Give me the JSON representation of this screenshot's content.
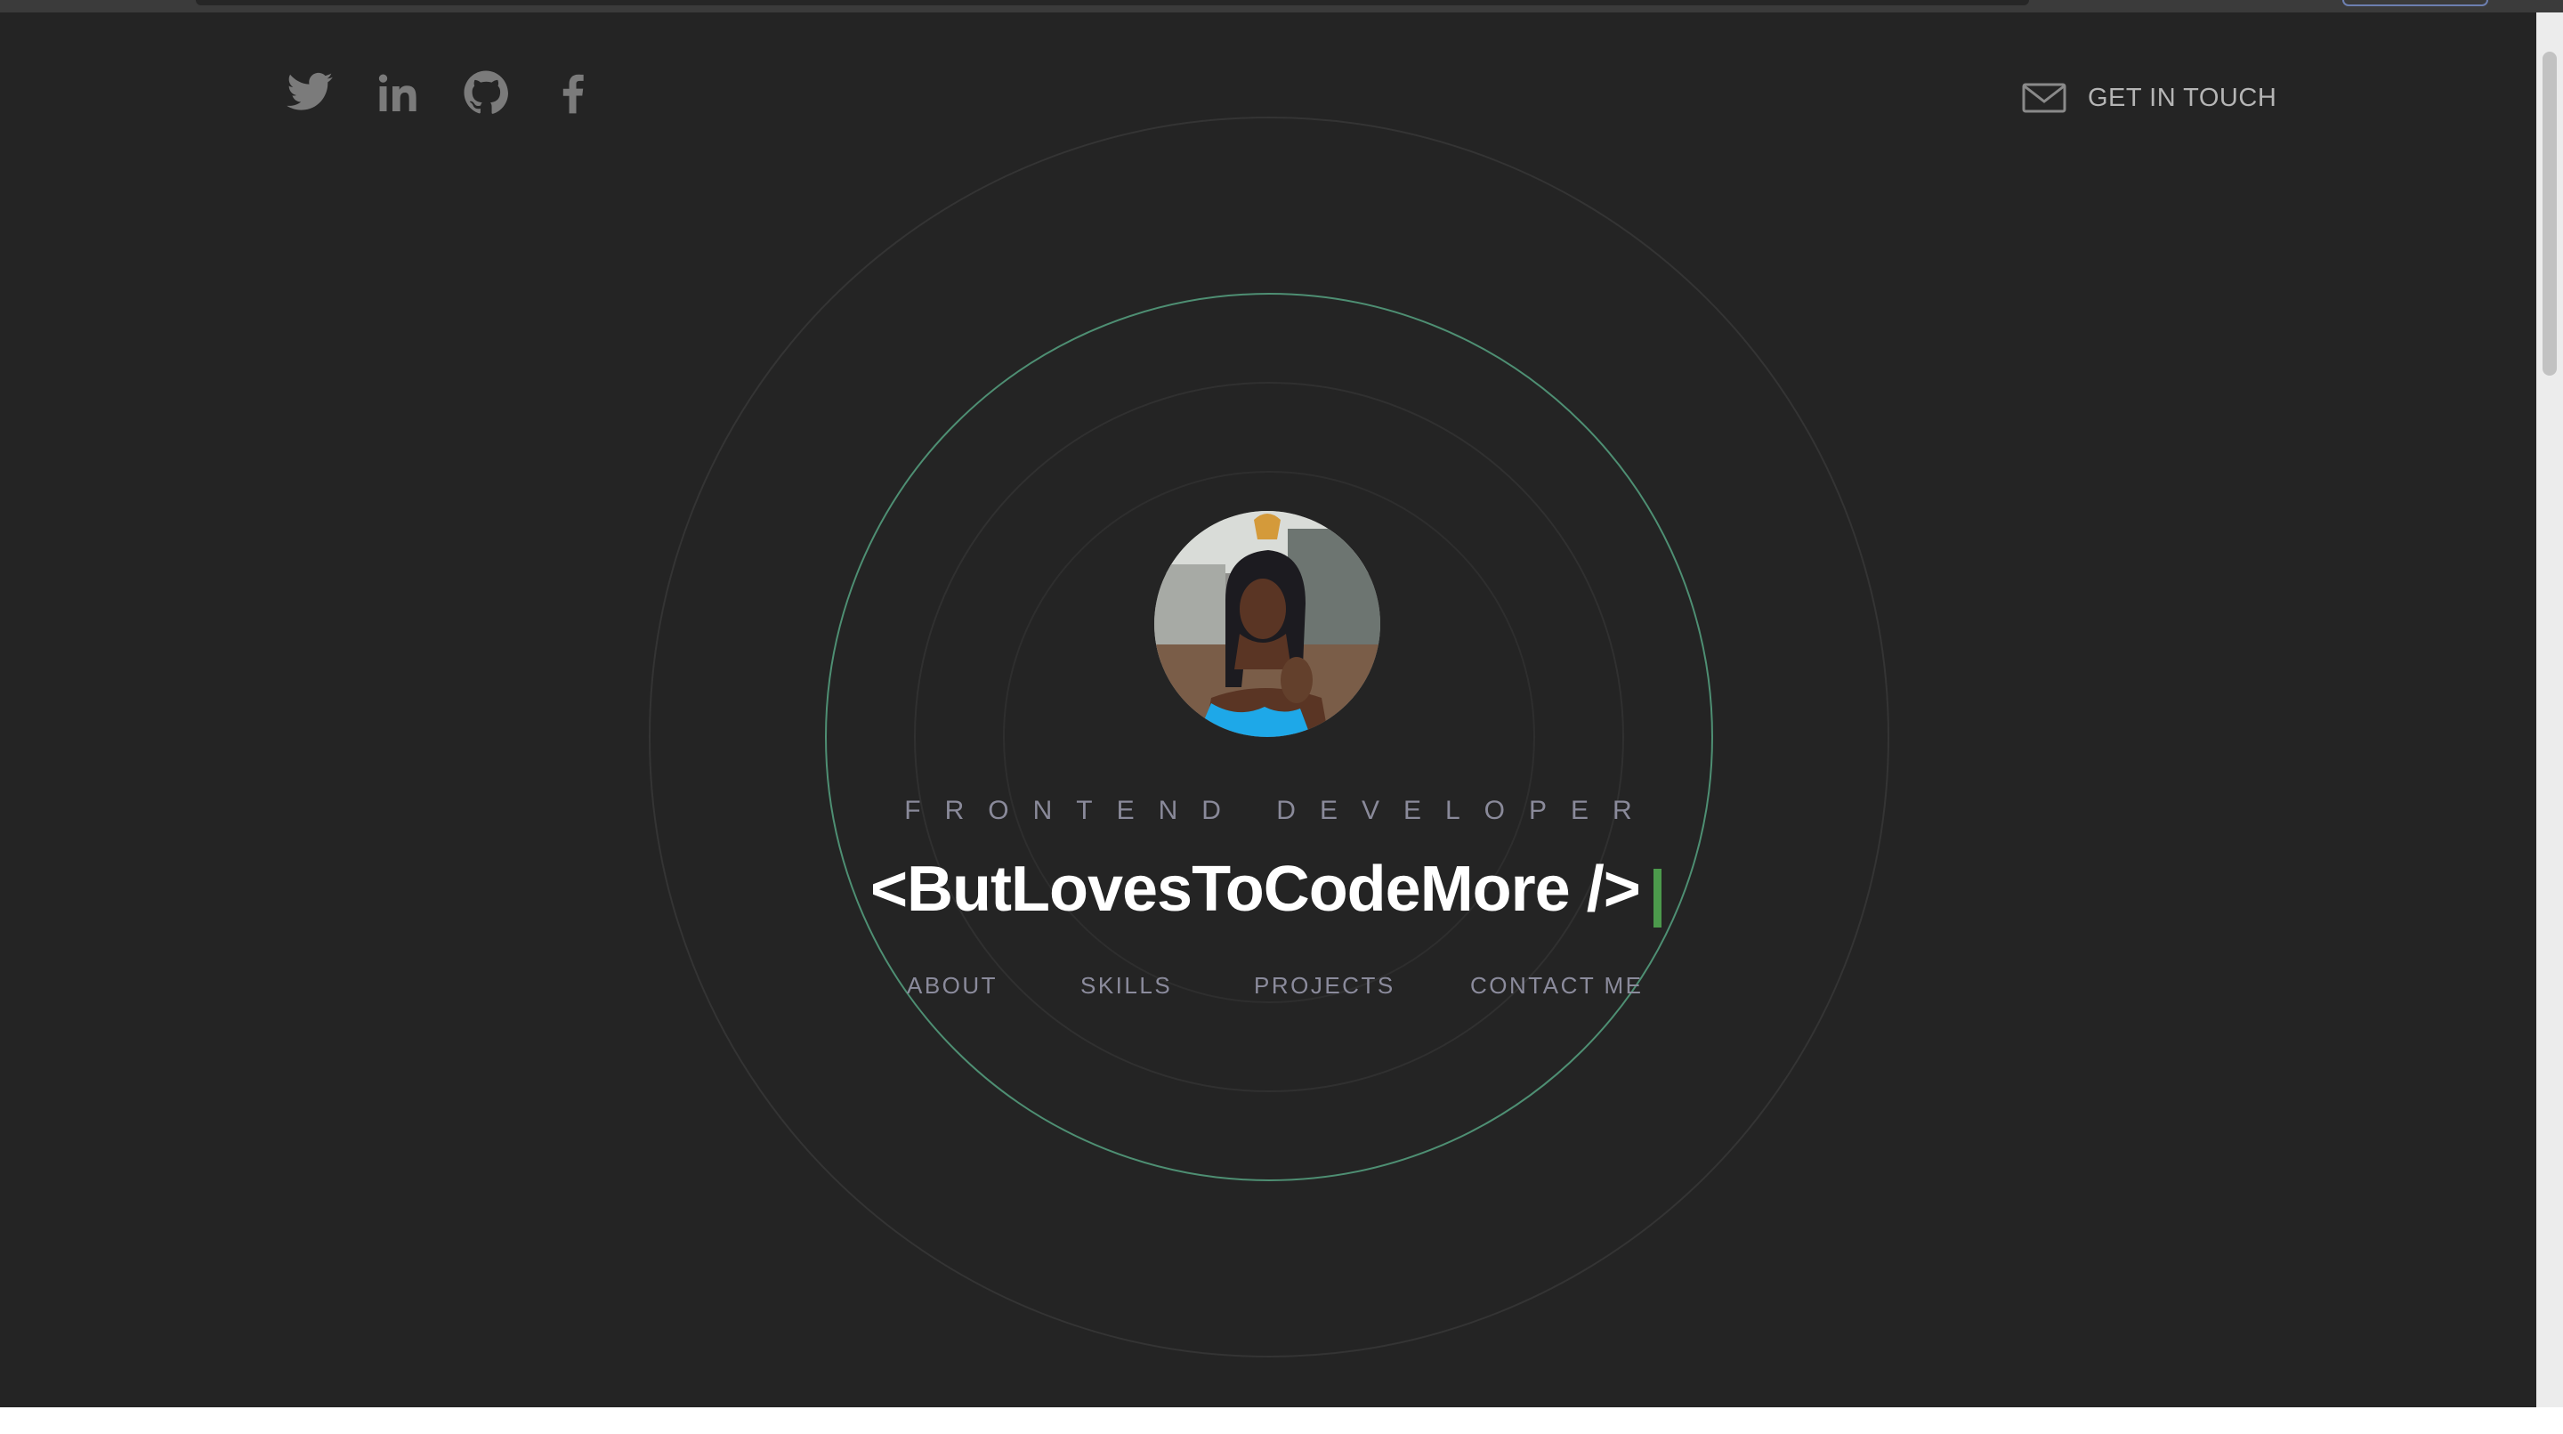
{
  "social": {
    "items": [
      {
        "name": "twitter-icon"
      },
      {
        "name": "linkedin-icon"
      },
      {
        "name": "github-icon"
      },
      {
        "name": "facebook-icon"
      }
    ]
  },
  "header": {
    "contact_label": "GET IN TOUCH"
  },
  "hero": {
    "avatar_alt": "profile photo",
    "role": "FRONTEND DEVELOPER",
    "headline": "<ButLovesToCodeMore />"
  },
  "nav": {
    "items": [
      {
        "label": "ABOUT"
      },
      {
        "label": "SKILLS"
      },
      {
        "label": "PROJECTS"
      },
      {
        "label": "CONTACT ME"
      }
    ]
  },
  "colors": {
    "background": "#242424",
    "accent_ring": "#4e8f73",
    "cursor": "#4c9a4c",
    "muted_text": "#8b8b9c",
    "heading": "#ffffff"
  }
}
